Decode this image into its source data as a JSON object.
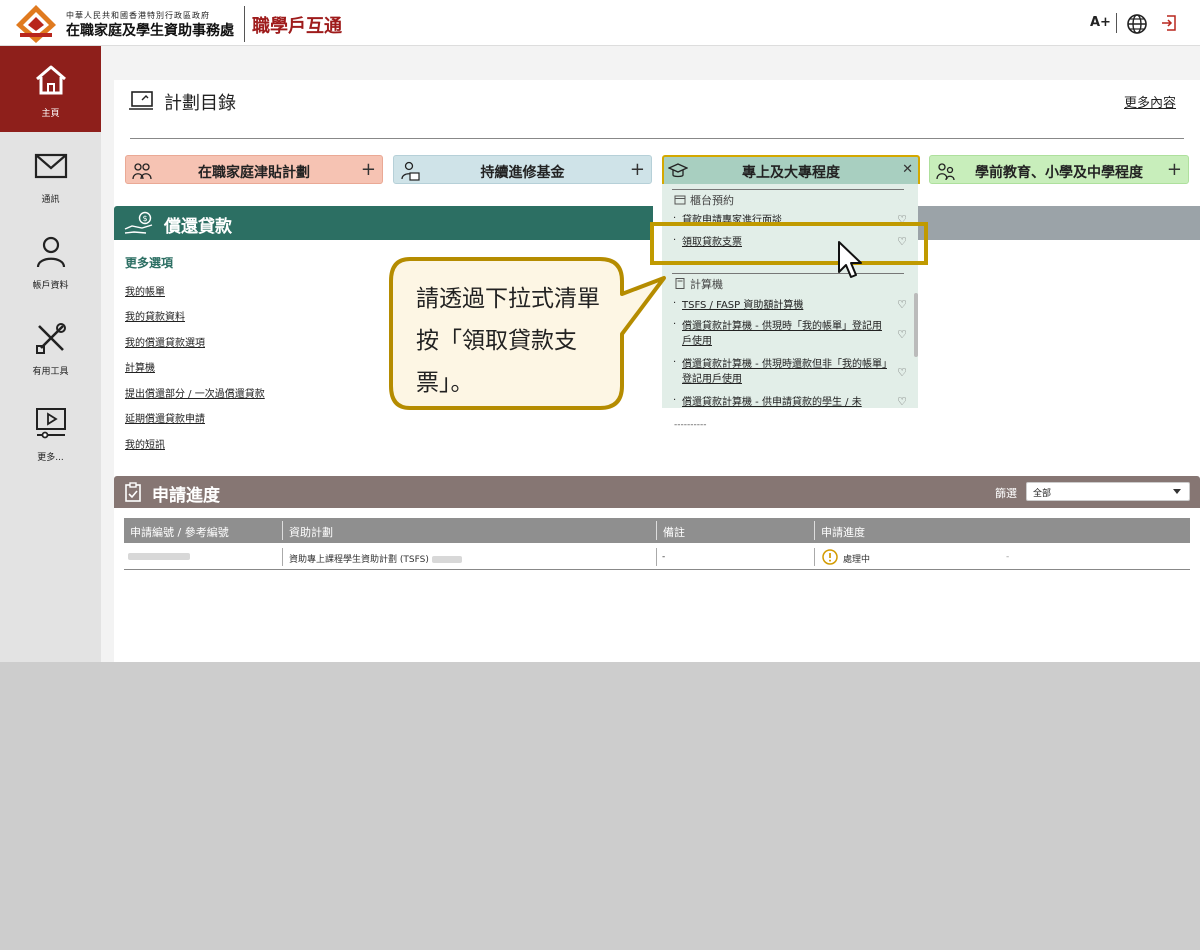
{
  "header": {
    "org_small": "中華人民共和國香港特別行政區政府",
    "org_name": "在職家庭及學生資助事務處",
    "brand": "職學戶互通",
    "font_size_label": "A+"
  },
  "sidebar": {
    "items": [
      {
        "label": "主頁",
        "icon": "home-icon",
        "active": true
      },
      {
        "label": "通訊",
        "icon": "mail-icon"
      },
      {
        "label": "帳戶資料",
        "icon": "user-icon"
      },
      {
        "label": "有用工具",
        "icon": "tools-icon"
      },
      {
        "label": "更多...",
        "icon": "media-icon"
      }
    ]
  },
  "catalog": {
    "title": "計劃目錄",
    "more_link": "更多內容",
    "categories": [
      {
        "label": "在職家庭津貼計劃",
        "color": "#f6c3b3"
      },
      {
        "label": "持續進修基金",
        "color": "#cfe3e8"
      },
      {
        "label": "專上及大專程度",
        "color": "#a8cfc0"
      },
      {
        "label": "學前教育、小學及中學程度",
        "color": "#c8eebb"
      }
    ]
  },
  "dropdown": {
    "section1": "櫃台預約",
    "item1": "貸款申請專家進行面談",
    "item2": "領取貸款支票",
    "section2": "計算機",
    "item3": "TSFS / FASP 資助額計算機",
    "item4": "償還貸款計算機 - 供現時「我的帳單」登記用戶使用",
    "item5": "償還貸款計算機 - 供現時還款但非「我的帳單」登記用戶使用",
    "item6": "償還貸款計算機 - 供申請貸款的學生 / 未",
    "dashes": "----------"
  },
  "repay": {
    "title": "償還貸款",
    "more_options": "更多選項",
    "links": [
      "我的帳單",
      "我的貸款資料",
      "我的償還貸款選項",
      "計算機",
      "提出償還部分 / 一次過償還貸款",
      "延期償還貸款申請",
      "我的短訊"
    ]
  },
  "callout": {
    "text": "請透過下拉式清單按「領取貸款支票」。"
  },
  "progress": {
    "title": "申請進度",
    "filter_label": "篩選",
    "filter_value": "全部",
    "columns": [
      "申請編號 / 參考編號",
      "資助計劃",
      "備註",
      "申請進度"
    ],
    "row": {
      "scheme": "資助專上課程學生資助計劃 (TSFS)",
      "remark": "-",
      "status": "處理中",
      "extra": "-"
    }
  },
  "colors": {
    "brand_red": "#8e1f1b",
    "teal": "#2c6f63",
    "highlight": "#c09a00",
    "progress_bar": "#867673"
  }
}
